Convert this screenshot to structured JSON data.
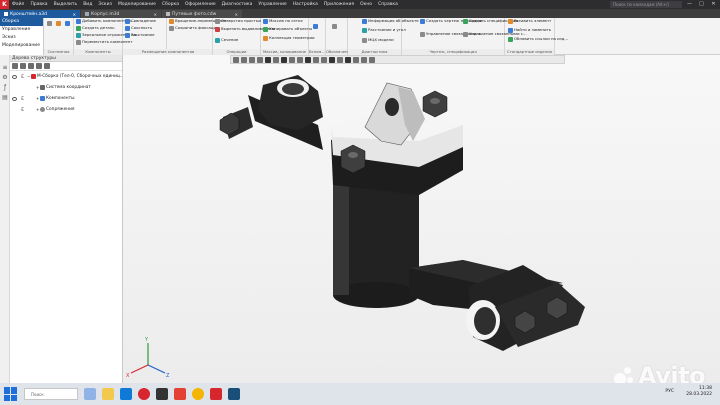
{
  "menubar": {
    "items": [
      "Файл",
      "Правка",
      "Выделить",
      "Вид",
      "Эскиз",
      "Моделирование",
      "Сборка",
      "Оформление",
      "Диагностика",
      "Управление",
      "Настройка",
      "Приложения",
      "Окно",
      "Справка"
    ],
    "search_placeholder": "Поиск по командам (Alt+/)"
  },
  "tabs": [
    {
      "label": "Кронштейн.a3d",
      "active": true
    },
    {
      "label": "Корпус.m3d",
      "active": false
    },
    {
      "label": "Путевые фото.cdw",
      "active": false
    }
  ],
  "ribbon": {
    "side_items": [
      "Сборка",
      "Управление",
      "Эскиз",
      "Моделирование"
    ],
    "side_items_extra": "моделирование",
    "groups": [
      {
        "title": "Системная",
        "commands": []
      },
      {
        "title": "Компоненты",
        "commands": [
          "Добавить компонент из...",
          "Создать деталь",
          "Зеркальное отражение ко...",
          "Переместить компонент"
        ]
      },
      {
        "title": "Размещение компонентов",
        "commands": [
          "Совпадение",
          "Соосность",
          "Расстояние"
        ]
      },
      {
        "title": "",
        "commands": [
          "Вращение-перемещение",
          "Сохранить фиксацию"
        ]
      },
      {
        "title": "Операции",
        "commands": [
          "Отверстия простых",
          "Вырезать выдавливанием",
          "Сечение"
        ]
      },
      {
        "title": "Массив, копирование",
        "commands": [
          "Массив по сетке",
          "Копировать объекты",
          "Коллекция геометрии"
        ]
      },
      {
        "title": "Вспом...",
        "commands": []
      },
      {
        "title": "Обозначения",
        "commands": []
      },
      {
        "title": "Диагностика",
        "commands": [
          "Информация об объекте",
          "Расстояние и угол",
          "МЦХ модели"
        ]
      },
      {
        "title": "Чертеж, спецификация",
        "commands": [
          "Создать чертеж по модели",
          "Управление связанными ч...",
          "Создать спецификацию...",
          "Управление связанными с..."
        ]
      },
      {
        "title": "Стандартные изделия",
        "commands": [
          "Вставить элемент",
          "Найти и заменить",
          "Обновить ссылки на изд..."
        ]
      }
    ]
  },
  "tree": {
    "title": "Дерево структуры",
    "rows": [
      {
        "label": "М-Сборка (Тел-0, Сборочных единиц...",
        "level": 0
      },
      {
        "label": "Система координат",
        "level": 1
      },
      {
        "label": "Компоненты",
        "level": 1
      },
      {
        "label": "Сопряжения",
        "level": 1
      }
    ]
  },
  "axes": {
    "x": "X",
    "y": "Y",
    "z": "Z"
  },
  "taskbar": {
    "search_placeholder": "Поиск",
    "lang": "РУС",
    "time": "11:38",
    "date": "28.03.2022"
  },
  "watermark": {
    "text": "Avito"
  },
  "colors": {
    "accent": "#1e5a9e",
    "part_dark": "#2b2b2b",
    "part_light": "#e4e4e4"
  }
}
